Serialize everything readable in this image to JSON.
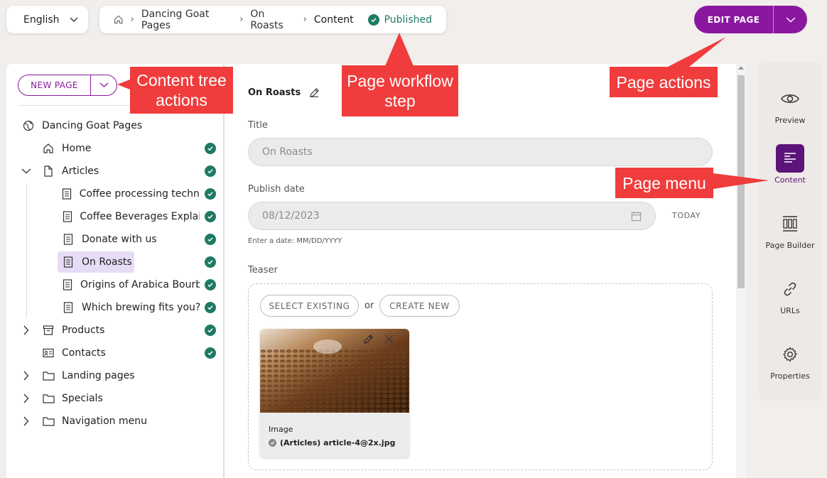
{
  "language": {
    "label": "English"
  },
  "breadcrumb": {
    "items": [
      "Dancing Goat Pages",
      "On Roasts",
      "Content"
    ],
    "status": "Published"
  },
  "header": {
    "edit_label": "EDIT PAGE"
  },
  "tree": {
    "new_page_label": "NEW PAGE",
    "root": "Dancing Goat Pages",
    "nodes": {
      "home": "Home",
      "articles": "Articles",
      "a1": "Coffee processing techniques",
      "a2": "Coffee Beverages Explained",
      "a3": "Donate with us",
      "a4": "On Roasts",
      "a5": "Origins of Arabica Bourbon",
      "a6": "Which brewing fits you?",
      "products": "Products",
      "contacts": "Contacts",
      "landing": "Landing pages",
      "specials": "Specials",
      "navigation": "Navigation menu"
    }
  },
  "content": {
    "page_name": "On Roasts",
    "title_label": "Title",
    "title_value": "On Roasts",
    "date_label": "Publish date",
    "date_value": "08/12/2023",
    "today_label": "TODAY",
    "date_hint": "Enter a date: MM/DD/YYYY",
    "teaser_label": "Teaser",
    "select_existing": "SELECT EXISTING",
    "or": "or",
    "create_new": "CREATE NEW",
    "card_type": "Image",
    "card_file": "(Articles) article-4@2x.jpg"
  },
  "rail": {
    "preview": "Preview",
    "content": "Content",
    "page_builder": "Page Builder",
    "urls": "URLs",
    "properties": "Properties"
  },
  "annotations": {
    "tree_actions": "Content tree actions",
    "workflow": "Page workflow step",
    "page_actions": "Page actions",
    "page_menu": "Page menu"
  },
  "colors": {
    "accent": "#8a189f",
    "status_ok": "#1f7a63",
    "annotation": "#f03c3c"
  }
}
